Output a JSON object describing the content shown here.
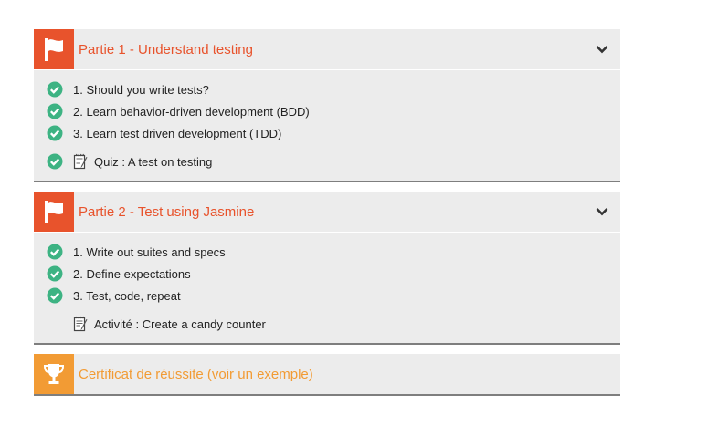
{
  "parts": [
    {
      "title": "Partie 1 - Understand testing",
      "items": [
        {
          "label": "1. Should you write tests?",
          "done": true
        },
        {
          "label": "2. Learn behavior-driven development (BDD)",
          "done": true
        },
        {
          "label": "3. Learn test driven development (TDD)",
          "done": true
        }
      ],
      "evaluation": {
        "label": "Quiz : A test on testing",
        "done": true
      }
    },
    {
      "title": "Partie 2 - Test using Jasmine",
      "items": [
        {
          "label": "1. Write out suites and specs",
          "done": true
        },
        {
          "label": "2. Define expectations",
          "done": true
        },
        {
          "label": "3. Test, code, repeat",
          "done": true
        }
      ],
      "evaluation": {
        "label": "Activité : Create a candy counter",
        "done": false
      }
    }
  ],
  "certificate": {
    "label": "Certificat de réussite (voir un exemple)"
  },
  "colors": {
    "accent": "#e8532c",
    "gold": "#f29b34",
    "check": "#3db383",
    "panel": "#ececec"
  },
  "icons": {
    "part": "flag-icon",
    "toggle": "chevron-down-icon",
    "done": "check-circle-icon",
    "evaluation": "notepad-icon",
    "certificate": "trophy-icon"
  }
}
